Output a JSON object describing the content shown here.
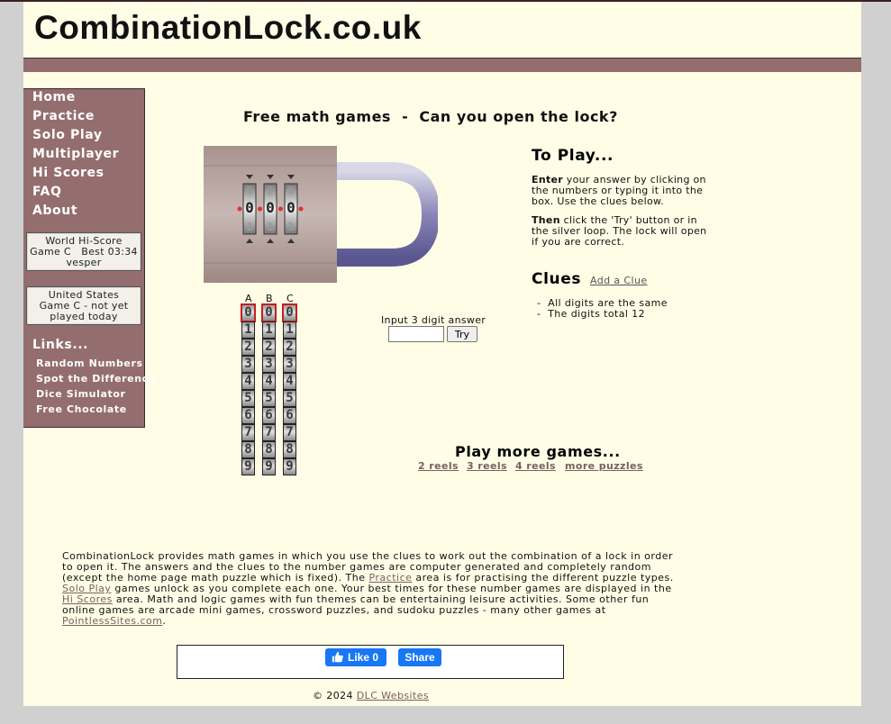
{
  "site": {
    "title": "CombinationLock.co.uk"
  },
  "sidebar": {
    "nav": [
      "Home",
      "Practice",
      "Solo Play",
      "Multiplayer",
      "Hi Scores",
      "FAQ",
      "About"
    ],
    "world_score": {
      "line1": "World Hi-Score",
      "line2": "Game C   Best 03:34",
      "line3": "vesper"
    },
    "country_score": {
      "line1": "United States",
      "line2": "Game C - not yet",
      "line3": "played today"
    },
    "links_heading": "Links...",
    "links": [
      "Random Numbers",
      "Spot the Difference",
      "Dice Simulator",
      "Free Chocolate"
    ]
  },
  "main": {
    "heading": "Free math games  -  Can you open the lock?",
    "lock": {
      "digits": [
        "0",
        "0",
        "0"
      ],
      "above": [
        "9",
        "9",
        "9"
      ],
      "below": [
        "1",
        "1",
        "1"
      ]
    },
    "columns": [
      "A",
      "B",
      "C"
    ],
    "reel_digits": [
      "0",
      "1",
      "2",
      "3",
      "4",
      "5",
      "6",
      "7",
      "8",
      "9"
    ],
    "selected": [
      "0",
      "0",
      "0"
    ],
    "input_label": "Input 3 digit answer",
    "input_value": "",
    "try_label": "Try"
  },
  "instructions": {
    "heading": "To Play...",
    "p1_bold": "Enter",
    "p1_rest": " your answer by clicking on the numbers or typing it into the box. Use the clues below.",
    "p2_bold": "Then",
    "p2_rest": " click the 'Try' button or in the silver loop. The lock will open if you are correct."
  },
  "clues": {
    "heading": "Clues",
    "add_link": "Add a Clue",
    "items": [
      "-  All digits are the same",
      "-  The digits total 12"
    ]
  },
  "more_games": {
    "heading": "Play more games...",
    "links": [
      "2 reels",
      "3 reels",
      "4 reels",
      "more puzzles"
    ]
  },
  "about": {
    "t1": "CombinationLock provides math games in which you use the clues to work out the combination of a lock in order to open it. The answers and the clues to the number games are computer generated and completely random (except the home page math puzzle which is fixed). The ",
    "l1": "Practice",
    "t2": " area is for practising the different puzzle types. ",
    "l2": "Solo Play",
    "t3": " games unlock as you complete each one. Your best times for these number games are displayed in the ",
    "l3": "Hi Scores",
    "t4": " area. Math and logic games with fun themes can be entertaining leisure activities. Some other fun online games are arcade mini games, crossword puzzles, and sudoku puzzles - many other games at ",
    "l4": "PointlessSites.com",
    "t5": "."
  },
  "social": {
    "like_label": "Like 0",
    "share_label": "Share"
  },
  "footer": {
    "copyright": "© 2024 ",
    "link": "DLC Websites"
  },
  "colors": {
    "sidebar": "#946e6e",
    "page_bg": "#fffde6",
    "facebook": "#1877f2",
    "reel_select": "#c62020"
  }
}
